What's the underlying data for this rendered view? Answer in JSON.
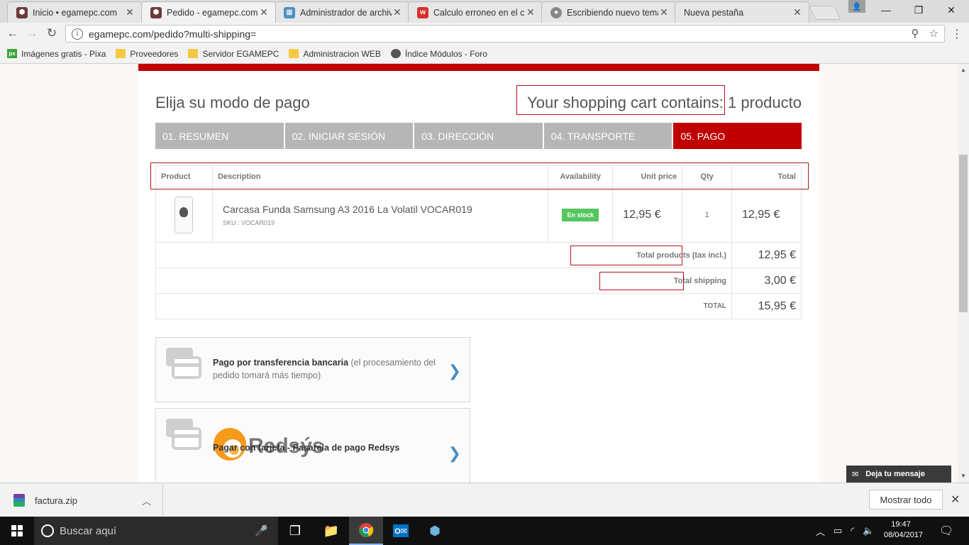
{
  "browser": {
    "tabs": [
      {
        "title": "Inicio • egamepc.com",
        "active": false,
        "favicon": "hexagon-icon"
      },
      {
        "title": "Pedido - egamepc.com",
        "active": true,
        "favicon": "hexagon-icon"
      },
      {
        "title": "Administrador de archiv",
        "active": false,
        "favicon": "file-manager-icon"
      },
      {
        "title": "Calculo erroneo en el ca",
        "active": false,
        "favicon": "forum-icon"
      },
      {
        "title": "Escribiendo nuevo tema",
        "active": false,
        "favicon": "chrome-icon"
      },
      {
        "title": "Nueva pestaña",
        "active": false,
        "favicon": ""
      }
    ],
    "url": "egamepc.com/pedido?multi-shipping=",
    "bookmarks": [
      {
        "label": "Imágenes gratis - Pixa",
        "icon": "pixabay-icon"
      },
      {
        "label": "Proveedores",
        "icon": "folder-icon"
      },
      {
        "label": "Servidor EGAMEPC",
        "icon": "folder-icon"
      },
      {
        "label": "Administracion WEB",
        "icon": "folder-icon"
      },
      {
        "label": "Índice Módulos - Foro",
        "icon": "prestashop-icon"
      }
    ]
  },
  "page": {
    "heading": "Elija su modo de pago",
    "cart_summary": "Your shopping cart contains:",
    "cart_count": "1 producto",
    "steps": [
      {
        "label": "01. RESUMEN",
        "active": false
      },
      {
        "label": "02. INICIAR SESIÓN",
        "active": false
      },
      {
        "label": "03. DIRECCIÓN",
        "active": false
      },
      {
        "label": "04. TRANSPORTE",
        "active": false
      },
      {
        "label": "05. PAGO",
        "active": true
      }
    ],
    "table": {
      "headers": [
        "Product",
        "Description",
        "Availability",
        "Unit price",
        "Qty",
        "Total"
      ],
      "product": {
        "name": "Carcasa Funda Samsung A3 2016 La Volatil VOCAR019",
        "sku": "SKU : VOCAR019",
        "availability": "En stock",
        "unit_price": "12,95 €",
        "qty": "1",
        "total": "12,95 €"
      },
      "summary": [
        {
          "label": "Total products (tax incl.)",
          "value": "12,95 €"
        },
        {
          "label": "Total shipping",
          "value": "3,00 €"
        },
        {
          "label": "TOTAL",
          "value": "15,95 €"
        }
      ]
    },
    "payment_options": [
      {
        "bold": "Pago por transferencia bancaria",
        "muted": " (el procesamiento del pedido tomará más tiempo)"
      },
      {
        "bold": "Pagar con tarjeta - Pasarela de pago Redsys",
        "logo": "Redsýs"
      }
    ],
    "chat_label": "Deja tu mensaje"
  },
  "downloads": {
    "file": "factura.zip",
    "show_all": "Mostrar todo"
  },
  "taskbar": {
    "search_placeholder": "Buscar aquí",
    "time": "19:47",
    "date": "08/04/2017"
  },
  "colors": {
    "brand_red": "#c00000",
    "step_inactive": "#b6b6b6",
    "stock_green": "#55c65e",
    "chevron_blue": "#4a8ec2",
    "highlight_box": "#b3161c"
  }
}
